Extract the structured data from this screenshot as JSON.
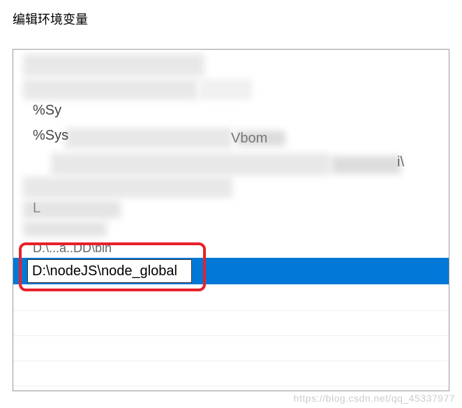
{
  "dialog": {
    "title": "编辑环境变量"
  },
  "list": {
    "partial_texts": {
      "row2": "%Sy",
      "row3_left": "%Sys",
      "row3_right": "Vbom",
      "row4_right": "i\\",
      "row5_left": "L",
      "row7": "D.\\...a..DD\\bin"
    },
    "editing_value": "D:\\nodeJS\\node_global"
  },
  "watermark": "https://blog.csdn.net/qq_45337977"
}
